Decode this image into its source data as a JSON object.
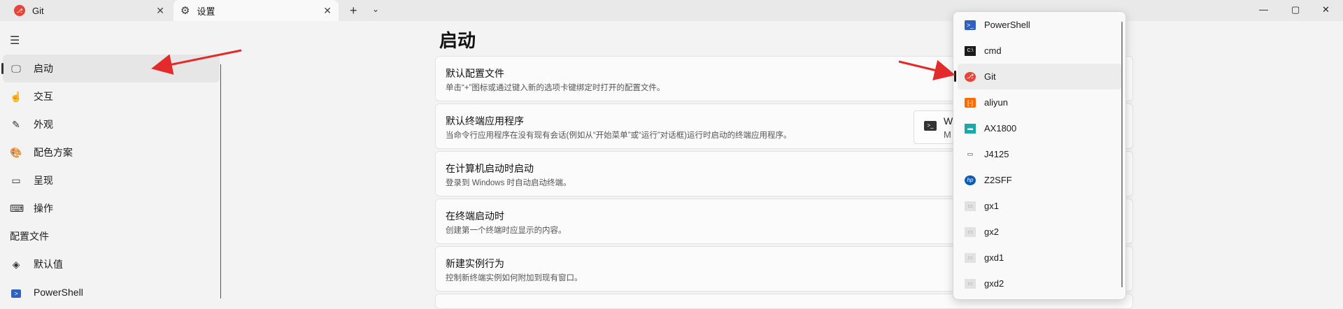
{
  "tabs": [
    {
      "label": "Git",
      "icon": "git-icon"
    },
    {
      "label": "设置",
      "icon": "gear-icon"
    }
  ],
  "tabbar": {
    "new_tab": "+",
    "dropdown": "⌄"
  },
  "window": {
    "minimize": "—",
    "maximize": "▢",
    "close": "✕"
  },
  "sidebar": {
    "items": [
      {
        "label": "启动",
        "icon": "startup-icon",
        "glyph": "🖵"
      },
      {
        "label": "交互",
        "icon": "interaction-icon",
        "glyph": "☝"
      },
      {
        "label": "外观",
        "icon": "appearance-icon",
        "glyph": "✎"
      },
      {
        "label": "配色方案",
        "icon": "palette-icon",
        "glyph": "🎨"
      },
      {
        "label": "呈现",
        "icon": "rendering-icon",
        "glyph": "▭"
      },
      {
        "label": "操作",
        "icon": "keyboard-icon",
        "glyph": "⌨"
      }
    ],
    "section_title": "配置文件",
    "profile_items": [
      {
        "label": "默认值",
        "icon": "layers-icon",
        "glyph": "◈"
      },
      {
        "label": "PowerShell",
        "icon": "powershell-icon",
        "glyph": ">"
      }
    ]
  },
  "main": {
    "title": "启动",
    "cards": [
      {
        "title": "默认配置文件",
        "desc": "单击“+”图标或通过键入新的选项卡键绑定时打开的配置文件。"
      },
      {
        "title": "默认终端应用程序",
        "desc": "当命令行应用程序在没有现有会话(例如从“开始菜单”或“运行”对话框)运行时启动的终端应用程序。"
      },
      {
        "title": "在计算机启动时启动",
        "desc": "登录到 Windows 时自动启动终端。"
      },
      {
        "title": "在终端启动时",
        "desc": "创建第一个终端时应显示的内容。"
      },
      {
        "title": "新建实例行为",
        "desc": "控制新终端实例如何附加到现有窗口。"
      }
    ],
    "terminal_select": {
      "line1": "W",
      "line2": "M"
    }
  },
  "flyout": {
    "selected_index": 2,
    "items": [
      {
        "label": "PowerShell",
        "icon": "powershell-icon",
        "glyph": ">_"
      },
      {
        "label": "cmd",
        "icon": "cmd-icon",
        "glyph": "C:\\"
      },
      {
        "label": "Git",
        "icon": "git-icon",
        "glyph": "⎇"
      },
      {
        "label": "aliyun",
        "icon": "aliyun-icon",
        "glyph": "[-]"
      },
      {
        "label": "AX1800",
        "icon": "ax1800-icon",
        "glyph": "▬"
      },
      {
        "label": "J4125",
        "icon": "j4125-icon",
        "glyph": "▭"
      },
      {
        "label": "Z2SFF",
        "icon": "hp-icon",
        "glyph": "hp"
      },
      {
        "label": "gx1",
        "icon": "gx1-icon",
        "glyph": "▭"
      },
      {
        "label": "gx2",
        "icon": "gx2-icon",
        "glyph": "▭"
      },
      {
        "label": "gxd1",
        "icon": "gxd1-icon",
        "glyph": "▭"
      },
      {
        "label": "gxd2",
        "icon": "gxd2-icon",
        "glyph": "▭"
      }
    ]
  },
  "colors": {
    "accent": "#e4463a",
    "arrow": "#e32b2b",
    "powershell": "#2f5fbf"
  }
}
